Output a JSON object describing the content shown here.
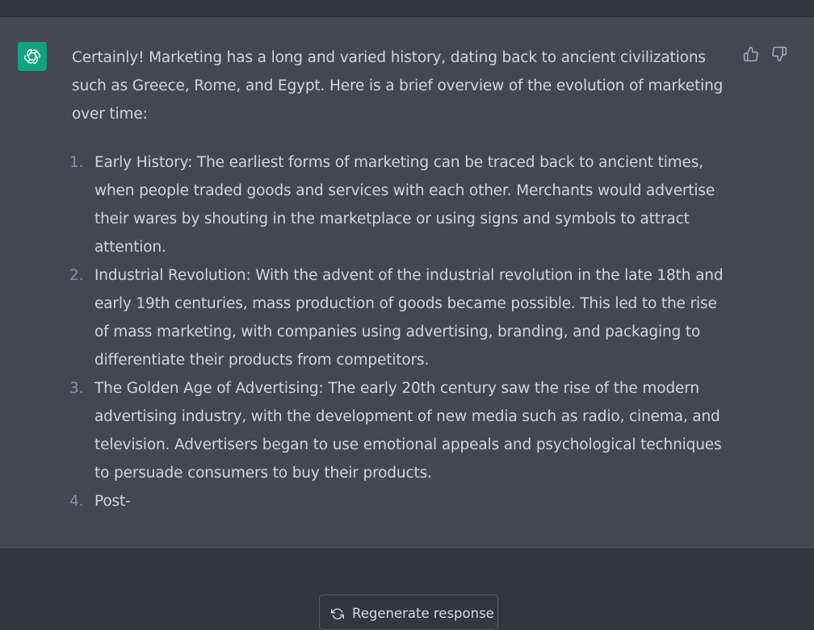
{
  "assistant": {
    "avatar_icon": "openai-logo-icon",
    "avatar_color": "#10a37f",
    "intro": "Certainly! Marketing has a long and varied history, dating back to ancient civilizations such as Greece, Rome, and Egypt. Here is a brief overview of the evolution of marketing over time:",
    "items": [
      {
        "num": "1.",
        "text": "Early History: The earliest forms of marketing can be traced back to ancient times, when people traded goods and services with each other. Merchants would advertise their wares by shouting in the marketplace or using signs and symbols to attract attention."
      },
      {
        "num": "2.",
        "text": "Industrial Revolution: With the advent of the industrial revolution in the late 18th and early 19th centuries, mass production of goods became possible. This led to the rise of mass marketing, with companies using advertising, branding, and packaging to differentiate their products from competitors."
      },
      {
        "num": "3.",
        "text": "The Golden Age of Advertising: The early 20th century saw the rise of the modern advertising industry, with the development of new media such as radio, cinema, and television. Advertisers began to use emotional appeals and psychological techniques to persuade consumers to buy their products."
      },
      {
        "num": "4.",
        "text": "Post-"
      }
    ]
  },
  "feedback": {
    "thumbs_up_icon": "thumbs-up-icon",
    "thumbs_down_icon": "thumbs-down-icon"
  },
  "footer": {
    "regenerate_label": "Regenerate response",
    "regenerate_icon": "refresh-icon"
  },
  "colors": {
    "page_bg": "#343541",
    "message_bg": "#444654",
    "text": "#d1d5db",
    "accent": "#10a37f"
  }
}
